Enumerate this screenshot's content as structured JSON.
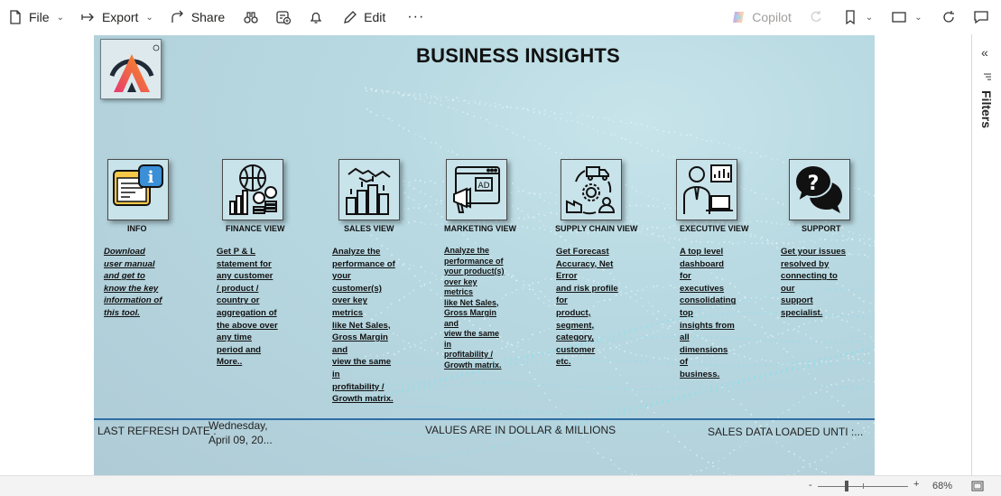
{
  "toolbar": {
    "file": "File",
    "export": "Export",
    "share": "Share",
    "edit": "Edit",
    "more": "···",
    "copilot": "Copilot"
  },
  "report": {
    "title": "BUSINESS INSIGHTS",
    "cards": [
      {
        "label": "INFO",
        "desc": [
          "Download",
          "user manual",
          "and get to",
          "know the key",
          "information of",
          "this tool."
        ],
        "icon": "info-icon"
      },
      {
        "label": "FINANCE VIEW",
        "desc": [
          "Get  P & L",
          "statement for",
          "any customer",
          "/ product /",
          "country or",
          "aggregation of",
          "the above over",
          "any time",
          "period and",
          "More.."
        ],
        "icon": "finance-icon"
      },
      {
        "label": "SALES VIEW",
        "desc": [
          "Analyze the",
          "performance of",
          "your customer(s)",
          "over key metrics",
          "like Net Sales,",
          "Gross Margin and",
          "view the same in",
          "profitability /",
          "Growth matrix."
        ],
        "icon": "sales-icon"
      },
      {
        "label": "MARKETING VIEW",
        "desc": [
          "Analyze the",
          "performance of",
          "your product(s)",
          "over key metrics",
          "like Net Sales,",
          "Gross Margin and",
          "view the same in",
          "profitability /",
          "Growth matrix."
        ],
        "icon": "marketing-icon"
      },
      {
        "label": "SUPPLY CHAIN VIEW",
        "desc": [
          "Get Forecast",
          "Accuracy, Net Error",
          "and risk profile for",
          "product, segment,",
          "category, customer",
          "etc."
        ],
        "icon": "supply-chain-icon"
      },
      {
        "label": "EXECUTIVE VIEW",
        "desc": [
          "A top level",
          "dashboard for",
          "executives",
          "consolidating top",
          "insights from all",
          "dimensions of",
          "business."
        ],
        "icon": "executive-icon"
      },
      {
        "label": "SUPPORT",
        "desc": [
          "Get your issues",
          "resolved by",
          "connecting to our",
          "support specialist."
        ],
        "icon": "support-icon"
      }
    ],
    "footer": {
      "refresh_label": "LAST REFRESH DATE :",
      "refresh_day": "Wednesday,",
      "refresh_date": "April 09, 20...",
      "units": "VALUES ARE IN DOLLAR & MILLIONS",
      "loaded": "SALES DATA LOADED UNTI :..."
    }
  },
  "filters_pane": {
    "label": "Filters"
  },
  "status_bar": {
    "minus": "-",
    "plus": "+",
    "zoom": "68%"
  },
  "colors": {
    "accent_line": "#2f6ea5",
    "canvas": "#b8d9e2"
  }
}
